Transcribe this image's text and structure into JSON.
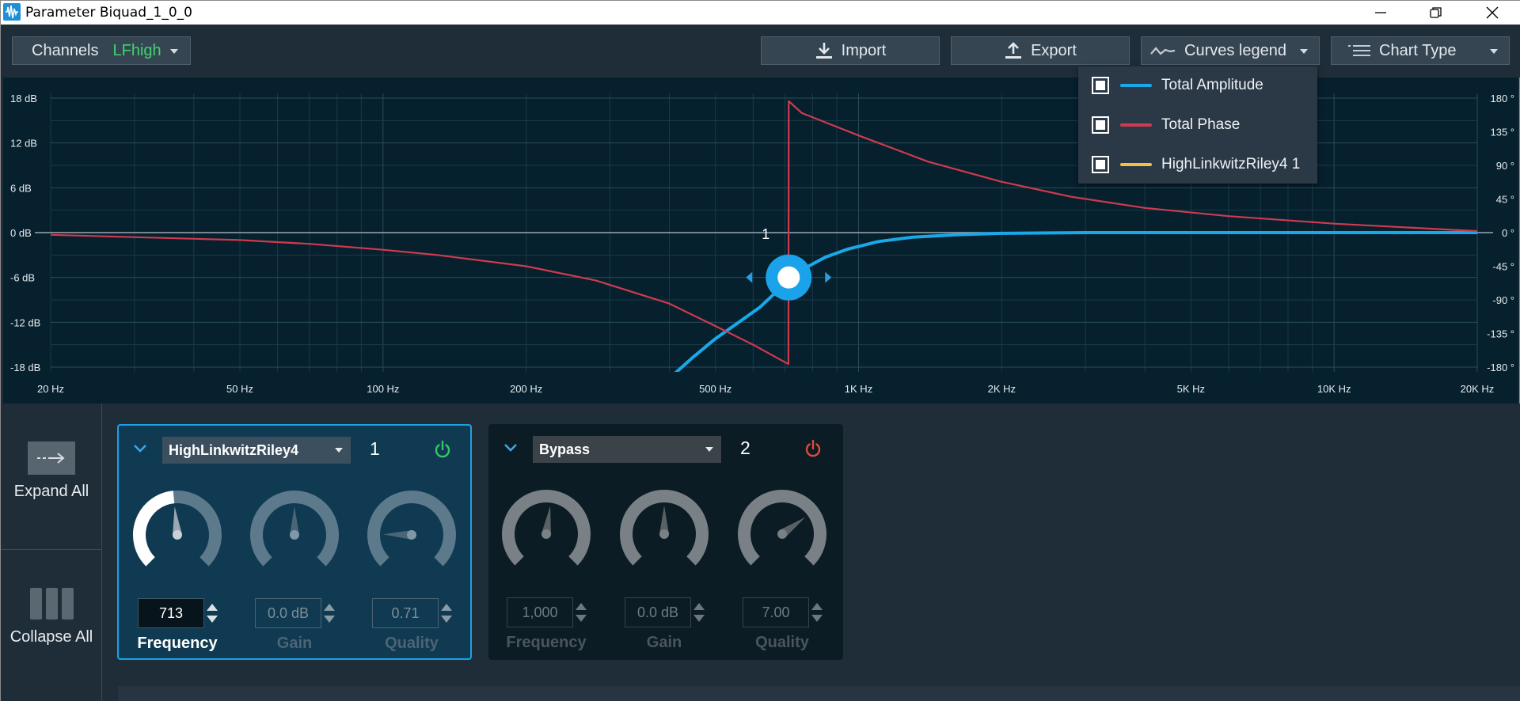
{
  "window": {
    "title": "Parameter Biquad_1_0_0",
    "icon": "waveform-app-icon",
    "controls": [
      "minimize-icon",
      "restore-icon",
      "close-icon"
    ]
  },
  "toolbar": {
    "channels_label": "Channels",
    "channels_value": "LFhigh",
    "import_label": "Import",
    "export_label": "Export",
    "curves_legend_label": "Curves legend",
    "chart_type_label": "Chart Type"
  },
  "legend": {
    "items": [
      {
        "label": "Total Amplitude",
        "color": "#19a9ea",
        "checked": true
      },
      {
        "label": "Total Phase",
        "color": "#d03a4f",
        "checked": true
      },
      {
        "label": "HighLinkwitzRiley4 1",
        "color": "#f2c045",
        "checked": true
      }
    ]
  },
  "chart_data": {
    "type": "line",
    "x_scale": "log",
    "xlim": [
      20,
      20000
    ],
    "ylim_left": [
      -18,
      18
    ],
    "ylim_right": [
      -180,
      180
    ],
    "grid": true,
    "left_ticks": [
      "18 dB",
      "12 dB",
      "6 dB",
      "0 dB",
      "-6 dB",
      "-12 dB",
      "-18 dB"
    ],
    "right_ticks": [
      "180 °",
      "135 °",
      "90 °",
      "45 °",
      "0 °",
      "-45 °",
      "-90 °",
      "-135 °",
      "-180 °"
    ],
    "x_ticks": [
      {
        "label": "20 Hz",
        "value": 20
      },
      {
        "label": "50 Hz",
        "value": 50
      },
      {
        "label": "100 Hz",
        "value": 100
      },
      {
        "label": "200 Hz",
        "value": 200
      },
      {
        "label": "500 Hz",
        "value": 500
      },
      {
        "label": "1K Hz",
        "value": 1000
      },
      {
        "label": "2K Hz",
        "value": 2000
      },
      {
        "label": "5K Hz",
        "value": 5000
      },
      {
        "label": "10K Hz",
        "value": 10000
      },
      {
        "label": "20K Hz",
        "value": 20000
      }
    ],
    "series": [
      {
        "name": "Total Amplitude",
        "axis": "left",
        "color": "#19a9ea",
        "x": [
          400,
          450,
          500,
          560,
          620,
          680,
          713,
          780,
          850,
          950,
          1100,
          1300,
          1600,
          2000,
          3000,
          5000,
          10000,
          20000
        ],
        "y": [
          -19.5,
          -16.6,
          -14.2,
          -12.0,
          -10.0,
          -7.6,
          -6.0,
          -4.6,
          -3.3,
          -2.2,
          -1.2,
          -0.6,
          -0.3,
          -0.1,
          0,
          0,
          0,
          0
        ]
      },
      {
        "name": "Total Phase",
        "axis": "right",
        "color": "#d03a4f",
        "x": [
          20,
          50,
          70,
          100,
          130,
          200,
          280,
          400,
          500,
          600,
          712,
          713,
          760,
          1000,
          1400,
          2000,
          2800,
          4000,
          6000,
          10000,
          20000
        ],
        "y": [
          -3,
          -10,
          -15,
          -23,
          -30,
          -45,
          -64,
          -95,
          -125,
          -150,
          -176,
          176,
          160,
          130,
          95,
          68,
          48,
          33,
          22,
          12,
          2
        ]
      }
    ],
    "filter_handle": {
      "label": "1",
      "frequency": 713,
      "gain_db": -6
    }
  },
  "side": {
    "expand_all": "Expand All",
    "collapse_all": "Collapse All"
  },
  "filters": [
    {
      "type": "HighLinkwitzRiley4",
      "index": "1",
      "enabled": true,
      "frequency": "713",
      "gain": "0.0 dB",
      "quality": "0.71",
      "frequency_label": "Frequency",
      "gain_label": "Gain",
      "quality_label": "Quality",
      "frequency_knob_fraction": 0.48,
      "gain_knob_fraction": 0.5,
      "quality_knob_fraction": 0.17
    },
    {
      "type": "Bypass",
      "index": "2",
      "enabled": false,
      "frequency": "1,000",
      "gain": "0.0 dB",
      "quality": "7.00",
      "frequency_label": "Frequency",
      "gain_label": "Gain",
      "quality_label": "Quality",
      "frequency_knob_fraction": 0.53,
      "gain_knob_fraction": 0.5,
      "quality_knob_fraction": 0.7
    }
  ]
}
